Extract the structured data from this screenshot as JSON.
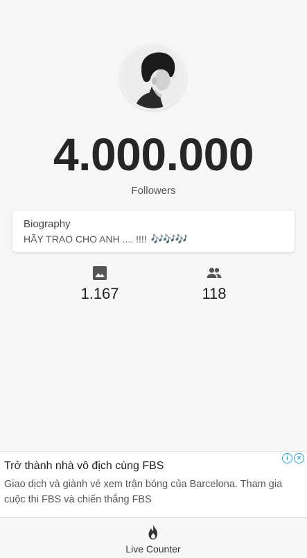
{
  "profile": {
    "avatar_icon": "avatar-photo",
    "follower_count": "4.000.000",
    "followers_label": "Followers"
  },
  "bio": {
    "title": "Biography",
    "text": "HÃY TRAO CHO ANH .... !!!!",
    "notes": "🎶🎶🎶"
  },
  "stats": {
    "posts": {
      "icon": "image-icon",
      "value": "1.167"
    },
    "following": {
      "icon": "people-icon",
      "value": "118"
    }
  },
  "ad": {
    "title": "Trở thành nhà vô địch cùng FBS",
    "body_line1": "Giao dịch và giành vé xem trận bóng của Barcelona. Tham gia",
    "body_line2": "cuộc thi FBS và chiến thắng FBS",
    "choices_info": "i",
    "choices_close": "×"
  },
  "nav": {
    "live_counter_label": "Live Counter",
    "live_counter_icon": "flame-icon"
  },
  "colors": {
    "background": "#f6f6f6",
    "count_text": "#262626",
    "ad_choices": "#1aa3d9"
  }
}
